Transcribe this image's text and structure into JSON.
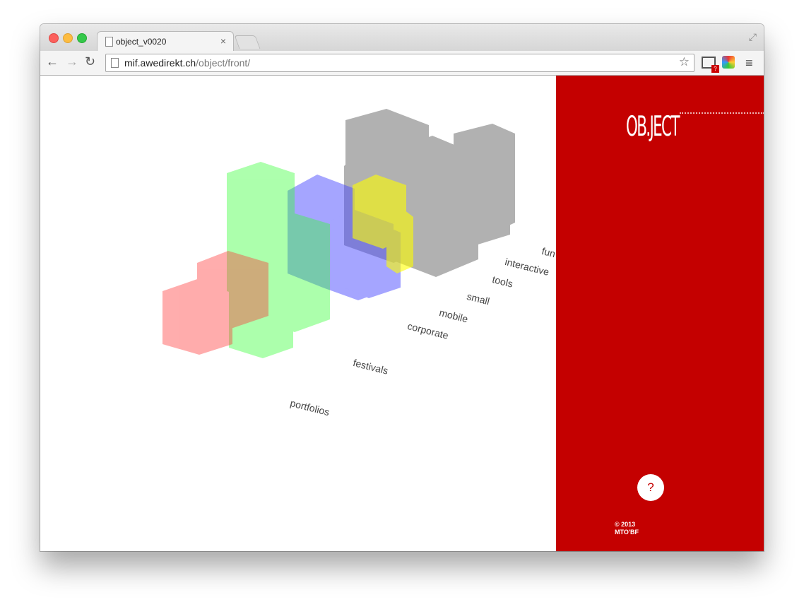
{
  "browser": {
    "tab_title": "object_v0020",
    "tab_close": "×",
    "url_host": "mif.awedirekt.ch",
    "url_path": "/object/front/",
    "ext_badge": "?"
  },
  "panel": {
    "logo": "OB.JECT",
    "help": "?",
    "copyright_line1": "© 2013",
    "copyright_line2": "MTO'BF"
  },
  "labels": [
    "fun",
    "interactive",
    "tools",
    "small",
    "mobile",
    "corporate",
    "festivals",
    "portfolios"
  ],
  "colors": {
    "panel_red": "#c40000",
    "cube_red": "#ff6666",
    "cube_green": "#66ff66",
    "cube_blue": "#4d4dff",
    "cube_yellow": "#ffff00",
    "cube_gray": "#555555"
  }
}
